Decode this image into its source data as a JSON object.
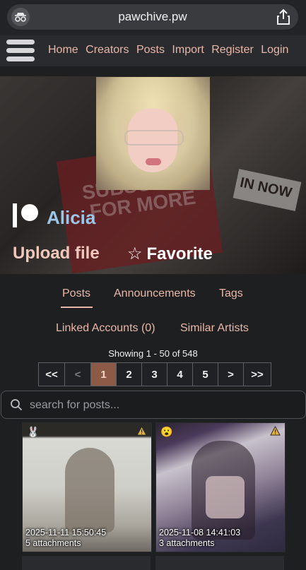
{
  "browser": {
    "url": "pawchive.pw"
  },
  "nav": {
    "links": [
      "Home",
      "Creators",
      "Posts",
      "Import",
      "Register",
      "Login"
    ]
  },
  "banner": {
    "sign_text": "SUBSCRIBE FOR MORE",
    "sign2_text": "IN NOW"
  },
  "artist": {
    "service_icon": "patreon-icon",
    "name": "Alicia",
    "upload_label": "Upload file",
    "favorite_star": "☆",
    "favorite_label": "Favorite"
  },
  "tabs": {
    "row1": [
      "Posts",
      "Announcements",
      "Tags"
    ],
    "row2": [
      "Linked Accounts (0)",
      "Similar Artists"
    ],
    "active": "Posts"
  },
  "paging": {
    "showing": "Showing 1 - 50 of 548",
    "buttons": [
      "<<",
      "<",
      "1",
      "2",
      "3",
      "4",
      "5",
      ">",
      ">>"
    ],
    "current": "1"
  },
  "search": {
    "placeholder": "search for posts..."
  },
  "posts": [
    {
      "badge": "🐰",
      "date": "2025-11-11 15:50:45",
      "attachments": "5 attachments"
    },
    {
      "badge": "😮",
      "date": "2025-11-08 14:41:03",
      "attachments": "3 attachments"
    }
  ],
  "colors": {
    "accent": "#e9b7a8",
    "artist_name": "#9cc6e8",
    "current_page": "#8c5a46"
  }
}
